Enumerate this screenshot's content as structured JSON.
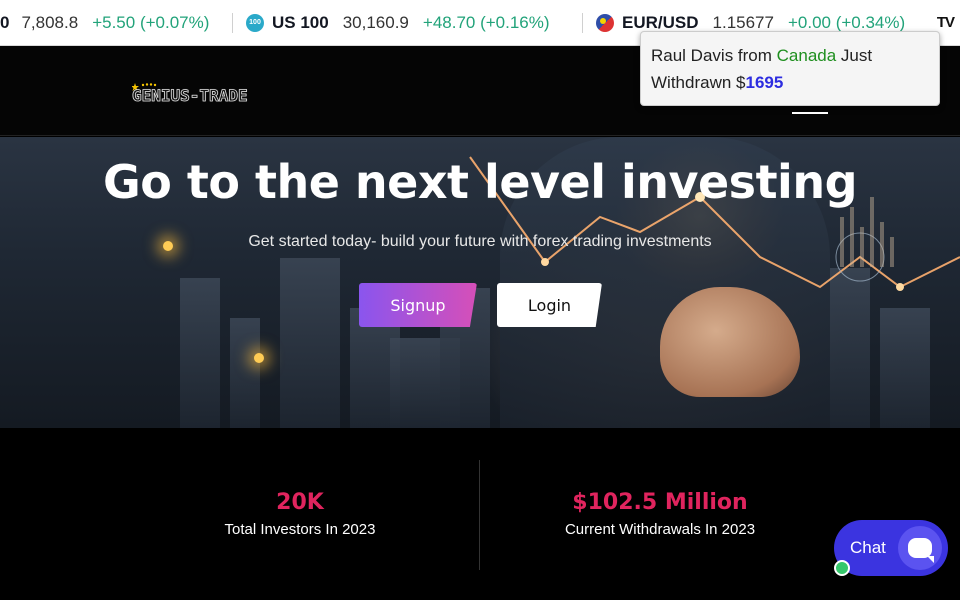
{
  "ticker": {
    "items": [
      {
        "symbol": "",
        "price": "7,808.8",
        "change": "+5.50 (+0.07%)",
        "icon": "none"
      },
      {
        "symbol": "US 100",
        "price": "30,160.9",
        "change": "+48.70 (+0.16%)",
        "icon": "us100-badge-icon",
        "badge": "100"
      },
      {
        "symbol": "EUR/USD",
        "price": "1.15677",
        "change": "+0.00 (+0.34%)",
        "icon": "eur-usd-flag-icon"
      }
    ],
    "lead_fragment": "0",
    "tv_logo": "TV",
    "change_color": "#22a37a"
  },
  "header": {
    "logo_text": "GENIUS-TRADE"
  },
  "notification": {
    "prefix": "Raul Davis from ",
    "country": "Canada",
    "middle": " Just Withdrawn $",
    "amount": "1695"
  },
  "hero": {
    "title": "Go to the next level investing",
    "subtitle": "Get started today- build your future with forex trading investments",
    "signup_label": "Signup",
    "login_label": "Login"
  },
  "stats": [
    {
      "value": "20K",
      "label": "Total Investors In 2023"
    },
    {
      "value": "$102.5 Million",
      "label": "Current Withdrawals In 2023"
    }
  ],
  "chat": {
    "label": "Chat"
  },
  "colors": {
    "accent_pink": "#e0245e",
    "chat_blue": "#3b34e0",
    "signup_gradient_start": "#8a55ee",
    "signup_gradient_end": "#d64fb8"
  }
}
